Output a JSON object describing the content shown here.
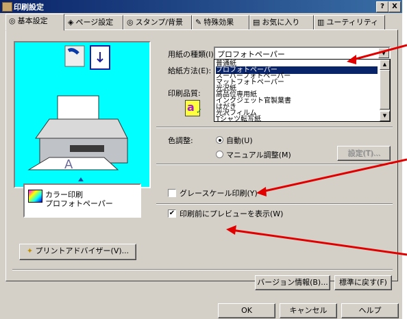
{
  "window": {
    "title": "印刷設定",
    "help_btn": "?",
    "close_btn": "X"
  },
  "tabs": [
    {
      "label": "基本設定",
      "icon": "◎"
    },
    {
      "label": "ページ設定",
      "icon": "◈"
    },
    {
      "label": "スタンプ/背景",
      "icon": "◎"
    },
    {
      "label": "特殊効果",
      "icon": "✎"
    },
    {
      "label": "お気に入り",
      "icon": "▤"
    },
    {
      "label": "ユーティリティ",
      "icon": "▥"
    }
  ],
  "media_type": {
    "label": "用紙の種類(I):",
    "selected": "プロフォトペーパー",
    "options": [
      "普通紙",
      "プロフォトペーパー",
      "スーパーフォトペーパー",
      "マットフォトペーパー",
      "光沢紙",
      "高品位専用紙",
      "インクジェット官製葉書",
      "はがき",
      "光沢フィルム",
      "Tシャツ転写紙"
    ]
  },
  "paper_source": {
    "label": "給紙方法(E):"
  },
  "print_quality": {
    "label": "印刷品質:"
  },
  "color_adjust": {
    "label": "色調整:",
    "auto_label": "自動(U)",
    "manual_label": "マニュアル調整(M)",
    "settings_button": "設定(T)..."
  },
  "grayscale": {
    "label": "グレースケール印刷(Y)",
    "checked": false
  },
  "preview_before_print": {
    "label": "印刷前にプレビューを表示(W)",
    "checked": true
  },
  "summary": {
    "line1": "カラー印刷",
    "line2": "プロフォトペーパー"
  },
  "advisor_button": "プリントアドバイザー(V)...",
  "version_button": "バージョン情報(B)...",
  "defaults_button": "標準に戻す(F)",
  "footer": {
    "ok": "OK",
    "cancel": "キャンセル",
    "help": "ヘルプ"
  },
  "colors": {
    "selection": "#0a246a",
    "preview_bg": "#00ffff",
    "annotation_arrow": "#e00000"
  }
}
